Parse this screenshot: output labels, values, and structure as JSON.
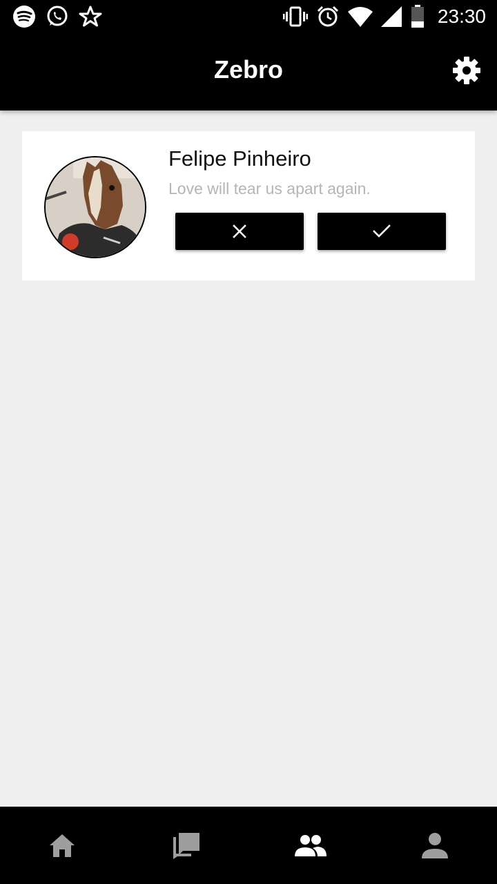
{
  "status_bar": {
    "time": "23:30",
    "left_icons": [
      "spotify-icon",
      "whatsapp-icon",
      "star-icon"
    ],
    "right_icons": [
      "vibrate-icon",
      "alarm-icon",
      "wifi-icon",
      "signal-icon",
      "battery-icon"
    ]
  },
  "app_bar": {
    "title": "Zebro",
    "action_icon": "settings-icon"
  },
  "request_card": {
    "name": "Felipe Pinheiro",
    "status": "Love will tear us apart again.",
    "reject_icon": "close-icon",
    "accept_icon": "check-icon"
  },
  "bottom_nav": {
    "items": [
      {
        "icon": "home-icon",
        "active": false
      },
      {
        "icon": "chat-icon",
        "active": false
      },
      {
        "icon": "people-icon",
        "active": true
      },
      {
        "icon": "person-icon",
        "active": false
      }
    ]
  },
  "colors": {
    "bar_background": "#000000",
    "page_background": "#efefef",
    "card_background": "#ffffff",
    "nav_inactive": "#9e9e9e",
    "nav_active": "#ffffff",
    "status_text": "#b5b5b5"
  }
}
